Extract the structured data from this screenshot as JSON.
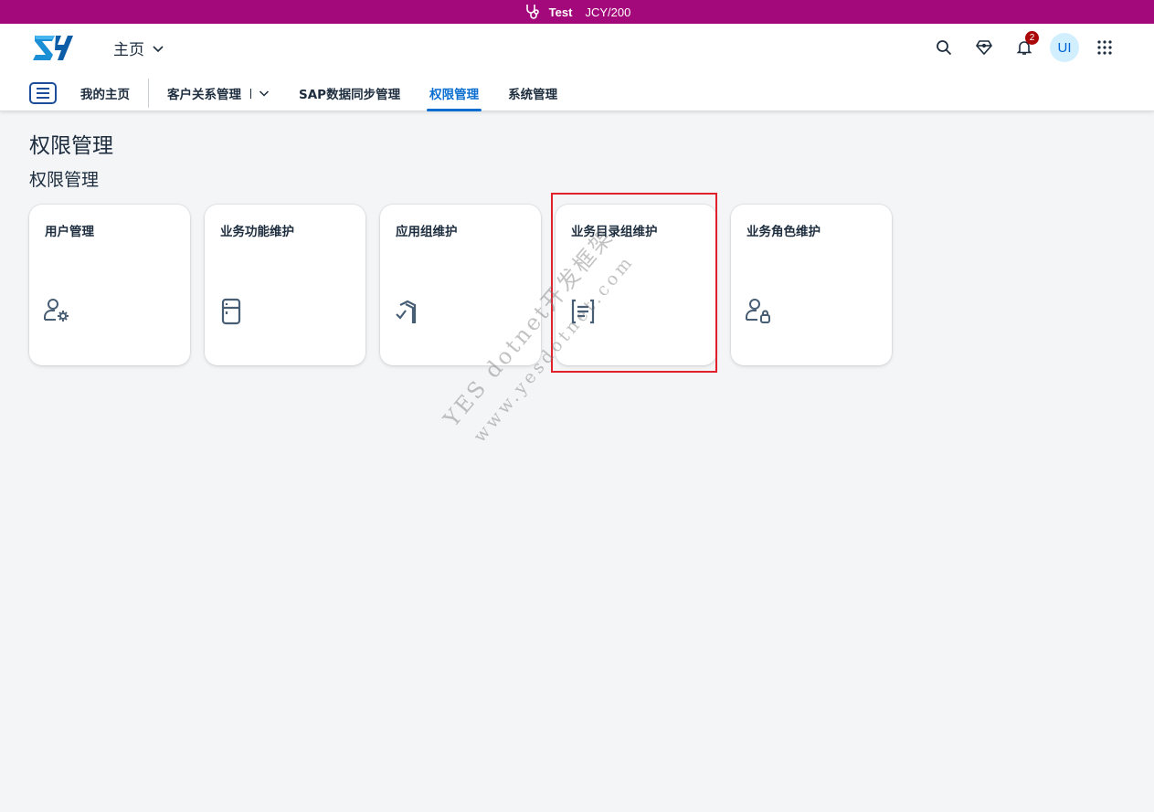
{
  "env_bar": {
    "label": "Test",
    "system": "JCY/200",
    "icon": "stethoscope-icon"
  },
  "header": {
    "logo_text": "ZY",
    "home_menu": "主页",
    "actions": {
      "search": "search-icon",
      "joule": "diamond-icon",
      "notifications": "bell-icon",
      "notification_count": "2",
      "avatar_initials": "UI",
      "apps": "grid-icon"
    }
  },
  "nav": {
    "items": [
      {
        "label": "我的主页"
      },
      {
        "label": "客户关系管理"
      },
      {
        "label": "SAP数据同步管理"
      },
      {
        "label": "权限管理",
        "active": true
      },
      {
        "label": "系统管理"
      }
    ]
  },
  "page": {
    "title": "权限管理",
    "section_title": "权限管理",
    "tiles": [
      {
        "title": "用户管理",
        "icon": "user-settings-icon"
      },
      {
        "title": "业务功能维护",
        "icon": "fridge-icon"
      },
      {
        "title": "应用组维护",
        "icon": "approval-group-icon"
      },
      {
        "title": "业务目录组维护",
        "icon": "document-text-icon",
        "highlighted": true
      },
      {
        "title": "业务角色维护",
        "icon": "user-lock-icon"
      }
    ]
  },
  "watermark": {
    "line1": "YES dotnet开发框架",
    "line2": "www.yesdotnet.com"
  },
  "colors": {
    "env_bar": "#a3097a",
    "accent": "#0a6ed1",
    "highlight": "#e0202a",
    "badge": "#aa0808"
  }
}
